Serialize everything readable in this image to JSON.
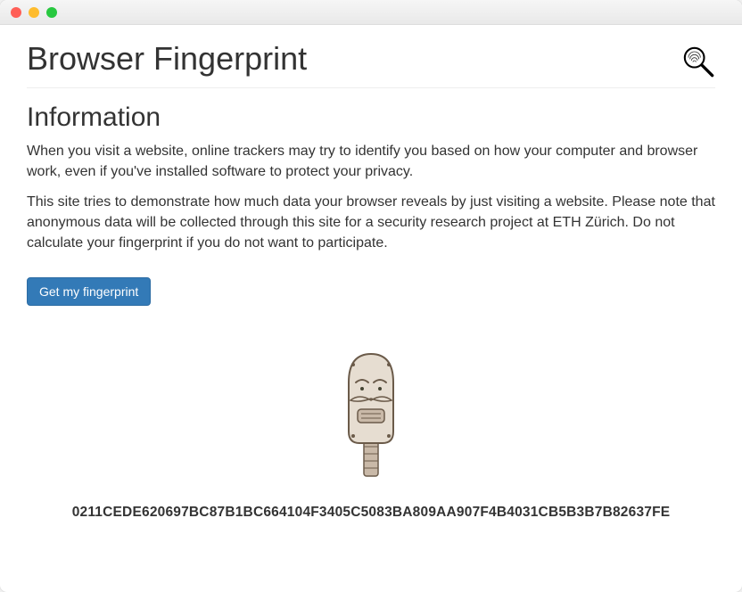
{
  "page": {
    "title": "Browser Fingerprint"
  },
  "section": {
    "heading": "Information",
    "para1": "When you visit a website, online trackers may try to identify you based on how your computer and browser work, even if you've installed software to protect your privacy.",
    "para2": "This site tries to demonstrate how much data your browser reveals by just visiting a website. Please note that anonymous data will be collected through this site for a security research project at ETH Zürich. Do not calculate your fingerprint if you do not want to participate."
  },
  "button": {
    "label": "Get my fingerprint"
  },
  "result": {
    "hash": "0211CEDE620697BC87B1BC664104F3405C5083BA809AA907F4B4031CB5B3B7B82637FE"
  }
}
